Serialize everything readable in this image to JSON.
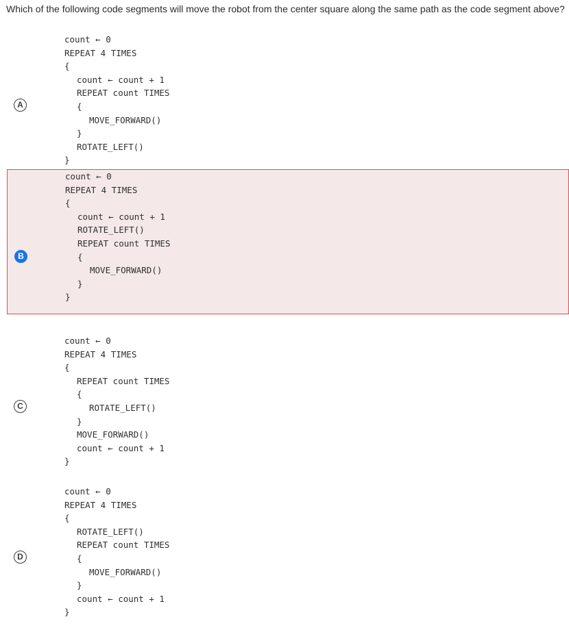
{
  "question": "Which of the following code segments will move the robot from the center square along the same path as the code segment above?",
  "choices": [
    {
      "letter": "A",
      "selected": false,
      "lines": [
        {
          "indent": 0,
          "text": "count ← 0"
        },
        {
          "indent": 0,
          "text": "REPEAT 4 TIMES"
        },
        {
          "indent": 0,
          "text": "{"
        },
        {
          "indent": 1,
          "text": "count ← count + 1"
        },
        {
          "indent": 1,
          "text": "REPEAT count TIMES"
        },
        {
          "indent": 1,
          "text": "{"
        },
        {
          "indent": 2,
          "text": "MOVE_FORWARD()"
        },
        {
          "indent": 1,
          "text": "}"
        },
        {
          "indent": 1,
          "text": "ROTATE_LEFT()"
        },
        {
          "indent": 0,
          "text": "}"
        }
      ]
    },
    {
      "letter": "B",
      "selected": true,
      "lines": [
        {
          "indent": 0,
          "text": "count ← 0"
        },
        {
          "indent": 0,
          "text": "REPEAT 4 TIMES"
        },
        {
          "indent": 0,
          "text": "{"
        },
        {
          "indent": 1,
          "text": "count ← count + 1"
        },
        {
          "indent": 1,
          "text": "ROTATE_LEFT()"
        },
        {
          "indent": 1,
          "text": "REPEAT count TIMES"
        },
        {
          "indent": 1,
          "text": "{"
        },
        {
          "indent": 2,
          "text": "MOVE_FORWARD()"
        },
        {
          "indent": 1,
          "text": "}"
        },
        {
          "indent": 0,
          "text": "}"
        }
      ]
    },
    {
      "letter": "C",
      "selected": false,
      "lines": [
        {
          "indent": 0,
          "text": "count ← 0"
        },
        {
          "indent": 0,
          "text": "REPEAT 4 TIMES"
        },
        {
          "indent": 0,
          "text": "{"
        },
        {
          "indent": 1,
          "text": "REPEAT count TIMES"
        },
        {
          "indent": 1,
          "text": "{"
        },
        {
          "indent": 2,
          "text": "ROTATE_LEFT()"
        },
        {
          "indent": 1,
          "text": "}"
        },
        {
          "indent": 1,
          "text": "MOVE_FORWARD()"
        },
        {
          "indent": 1,
          "text": "count ← count + 1"
        },
        {
          "indent": 0,
          "text": "}"
        }
      ]
    },
    {
      "letter": "D",
      "selected": false,
      "lines": [
        {
          "indent": 0,
          "text": "count ← 0"
        },
        {
          "indent": 0,
          "text": "REPEAT 4 TIMES"
        },
        {
          "indent": 0,
          "text": "{"
        },
        {
          "indent": 1,
          "text": "ROTATE_LEFT()"
        },
        {
          "indent": 1,
          "text": "REPEAT count TIMES"
        },
        {
          "indent": 1,
          "text": "{"
        },
        {
          "indent": 2,
          "text": "MOVE_FORWARD()"
        },
        {
          "indent": 1,
          "text": "}"
        },
        {
          "indent": 1,
          "text": "count ← count + 1"
        },
        {
          "indent": 0,
          "text": "}"
        }
      ]
    }
  ],
  "colors": {
    "selected_background": "#f4e8e8",
    "selected_border": "#d9534f",
    "selected_letter": "#1a73e8"
  }
}
